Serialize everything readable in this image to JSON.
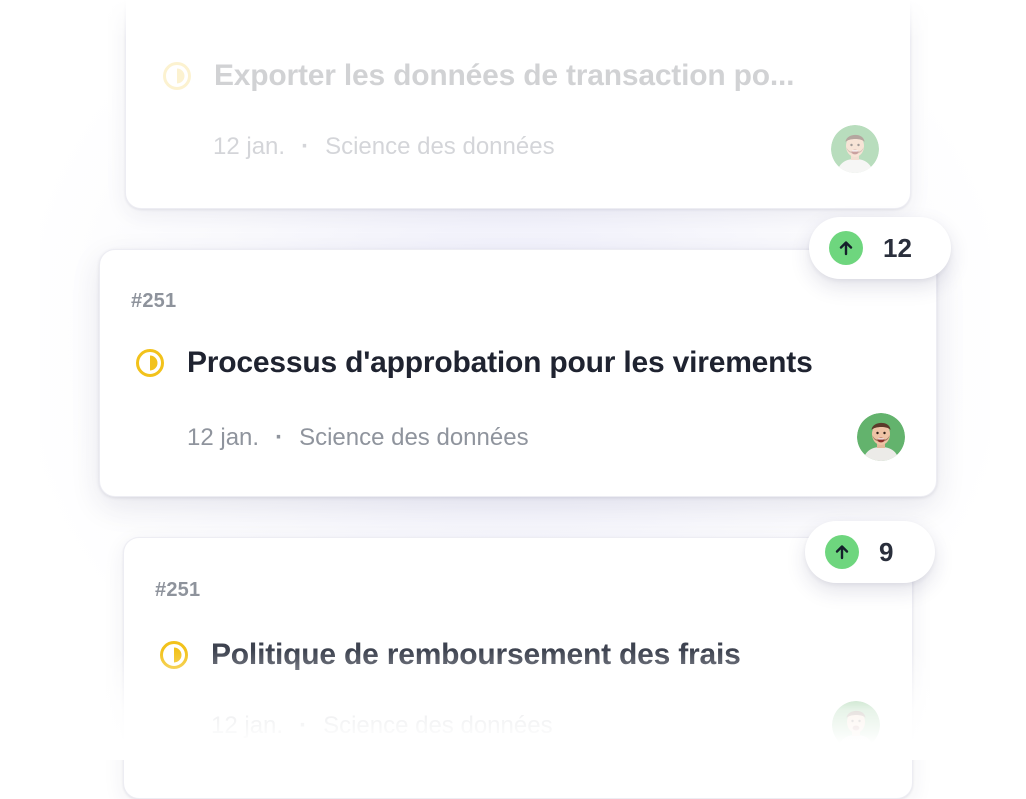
{
  "cards": [
    {
      "issue_id": "",
      "title": "Exporter les données de transaction po...",
      "date": "12 jan.",
      "separator": "·",
      "team": "Science des données",
      "status_icon": "half-circle-status-icon",
      "avatar": "user-avatar"
    },
    {
      "issue_id": "#251",
      "title": "Processus d'approbation pour les virements",
      "date": "12 jan.",
      "separator": "·",
      "team": "Science des données",
      "status_icon": "half-circle-status-icon",
      "avatar": "user-avatar",
      "votes": "12"
    },
    {
      "issue_id": "#251",
      "title": "Politique de remboursement des frais",
      "date": "12 jan.",
      "separator": "·",
      "team": "Science des données",
      "status_icon": "half-circle-status-icon",
      "avatar": "user-avatar",
      "votes": "9"
    }
  ],
  "colors": {
    "status_yellow": "#f2c21b",
    "upvote_green": "#6ed67e",
    "title_dark": "#1f2330",
    "muted_gray": "#8f949d"
  }
}
